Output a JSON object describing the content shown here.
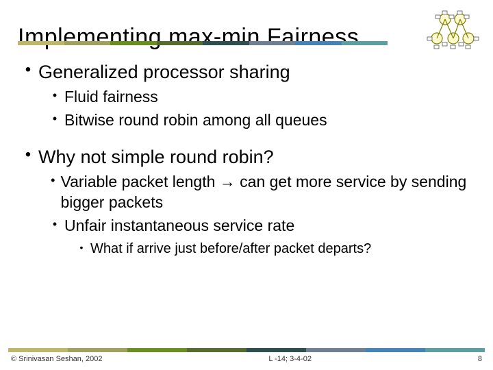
{
  "title": "Implementing max-min Fairness",
  "bullets": {
    "b1": {
      "text": "Generalized processor sharing"
    },
    "b1_1": {
      "text": "Fluid fairness"
    },
    "b1_2": {
      "text": "Bitwise round robin among all queues"
    },
    "b2": {
      "text": "Why not simple round robin?"
    },
    "b2_1": {
      "text": "Variable packet length → can get more service by sending bigger packets"
    },
    "b2_2": {
      "text": "Unfair instantaneous service rate"
    },
    "b2_2_1": {
      "text": "What if arrive just before/after packet departs?"
    }
  },
  "footer": {
    "left": "© Srinivasan Seshan, 2002",
    "center": "L -14; 3-4-02",
    "right": "8"
  }
}
